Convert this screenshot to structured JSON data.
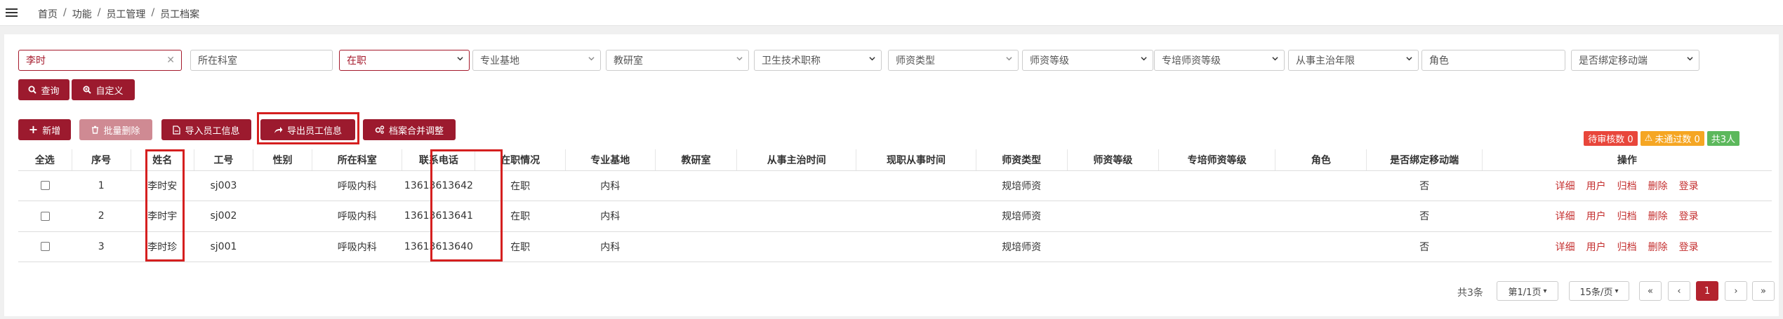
{
  "breadcrumb": [
    "首页",
    "功能",
    "员工管理",
    "员工档案"
  ],
  "filters": {
    "name_value": "李时",
    "department_placeholder": "所在科室",
    "status_value": "在职",
    "base_placeholder": "专业基地",
    "teaching_placeholder": "教研室",
    "title_placeholder": "卫生技术职称",
    "teacher_type_placeholder": "师资类型",
    "teacher_level_placeholder": "师资等级",
    "special_level_placeholder": "专培师资等级",
    "years_placeholder": "从事主治年限",
    "role_placeholder": "角色",
    "mobile_bind_placeholder": "是否绑定移动端"
  },
  "actions": {
    "query": "查询",
    "custom": "自定义",
    "add": "新增",
    "batch_delete": "批量删除",
    "import": "导入员工信息",
    "export": "导出员工信息",
    "merge": "档案合并调整"
  },
  "badges": {
    "pending": "待审核数 0",
    "rejected": "未通过数 0",
    "total": "共3人"
  },
  "table": {
    "headers": [
      "全选",
      "序号",
      "姓名",
      "工号",
      "性别",
      "所在科室",
      "联系电话",
      "在职情况",
      "专业基地",
      "教研室",
      "从事主治时间",
      "现职从事时间",
      "师资类型",
      "师资等级",
      "专培师资等级",
      "角色",
      "是否绑定移动端",
      "操作"
    ],
    "rows": [
      {
        "no": "1",
        "name": "李时安",
        "id": "sj003",
        "gender": "",
        "dept": "呼吸内科",
        "phone": "13613613642",
        "status": "在职",
        "base": "内科",
        "teach": "",
        "t1": "",
        "t2": "",
        "ttype": "规培师资",
        "tlevel": "",
        "slevel": "",
        "role": "",
        "bind": "否"
      },
      {
        "no": "2",
        "name": "李时宇",
        "id": "sj002",
        "gender": "",
        "dept": "呼吸内科",
        "phone": "13613613641",
        "status": "在职",
        "base": "内科",
        "teach": "",
        "t1": "",
        "t2": "",
        "ttype": "规培师资",
        "tlevel": "",
        "slevel": "",
        "role": "",
        "bind": "否"
      },
      {
        "no": "3",
        "name": "李时珍",
        "id": "sj001",
        "gender": "",
        "dept": "呼吸内科",
        "phone": "13613613640",
        "status": "在职",
        "base": "内科",
        "teach": "",
        "t1": "",
        "t2": "",
        "ttype": "规培师资",
        "tlevel": "",
        "slevel": "",
        "role": "",
        "bind": "否"
      }
    ],
    "ops": [
      "详细",
      "用户",
      "归档",
      "删除",
      "登录"
    ]
  },
  "pagination": {
    "total": "共3条",
    "page": "第1/1页",
    "size": "15条/页",
    "first": "«",
    "prev": "‹",
    "current": "1",
    "next": "›",
    "last": "»"
  },
  "colors": {
    "brand": "#9c1a2e",
    "highlight": "#d51f1f",
    "badge_red": "#e8463b",
    "badge_orange": "#f5a623",
    "badge_green": "#5cb85c"
  }
}
